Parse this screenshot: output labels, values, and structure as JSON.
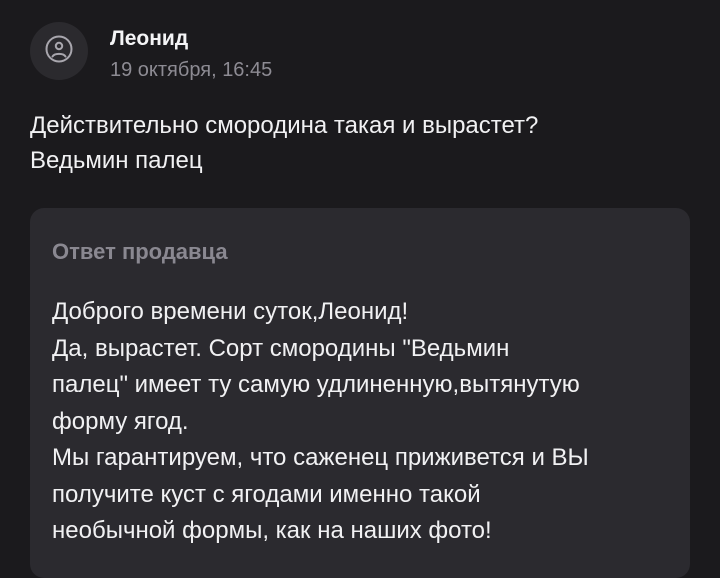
{
  "review": {
    "author": "Леонид",
    "date": "19 октября, 16:45",
    "avatar_icon": "sad-face-icon",
    "text": "Действительно смородина такая и вырастет?\nВедьмин палец"
  },
  "seller_reply": {
    "title": "Ответ продавца",
    "text": "Доброго времени суток,Леонид!\nДа, вырастет. Сорт смородины \"Ведьмин\nпалец\" имеет ту самую удлиненную,вытянутую\nформу ягод.\nМы гарантируем, что саженец приживется и ВЫ\nполучите куст с ягодами именно такой\nнеобычной формы, как на наших фото!"
  },
  "colors": {
    "background": "#1b1a1d",
    "card": "#2b2a2f",
    "muted_text": "#8d8b93",
    "primary_text": "#f1f1f3"
  }
}
